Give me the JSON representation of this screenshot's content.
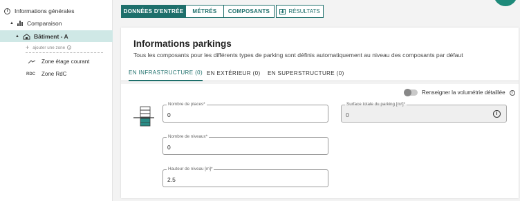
{
  "sidebar": {
    "general_info": "Informations générales",
    "comparison": "Comparaison",
    "building": "Bâtiment - A",
    "add_zone": "ajouter une zone",
    "zones": [
      {
        "icon": "zone-wave-icon",
        "label": "Zone étage courant"
      },
      {
        "icon": "RDC",
        "label": "Zone RdC"
      }
    ]
  },
  "tabs": {
    "donnees": "DONNÉES D'ENTRÉE",
    "metres": "MÉTRÉS",
    "composants": "COMPOSANTS",
    "resultats": "RÉSULTATS"
  },
  "card": {
    "title": "Informations parkings",
    "subtitle": "Tous les composants pour les différents types de parking sont définis automatiquement au niveau des composants par défaut",
    "subtabs": [
      "EN INFRASTRUCTURE (0)",
      "EN EXTÉRIEUR (0)",
      "EN SUPERSTRUCTURE (0)"
    ],
    "toggle_label": "Renseigner la volumétrie détaillée",
    "toggle_on": false
  },
  "fields": {
    "places": {
      "label": "Nombre de places*",
      "value": "0"
    },
    "surface": {
      "label": "Surface totale du parking [m²]*",
      "value": "0"
    },
    "niveaux": {
      "label": "Nombre de niveaux*",
      "value": "0"
    },
    "hauteur": {
      "label": "Hauteur de niveau [m]*",
      "value": "2.5"
    }
  },
  "colors": {
    "accent": "#1e6f6b",
    "selected_bg": "#cfe8e6"
  }
}
